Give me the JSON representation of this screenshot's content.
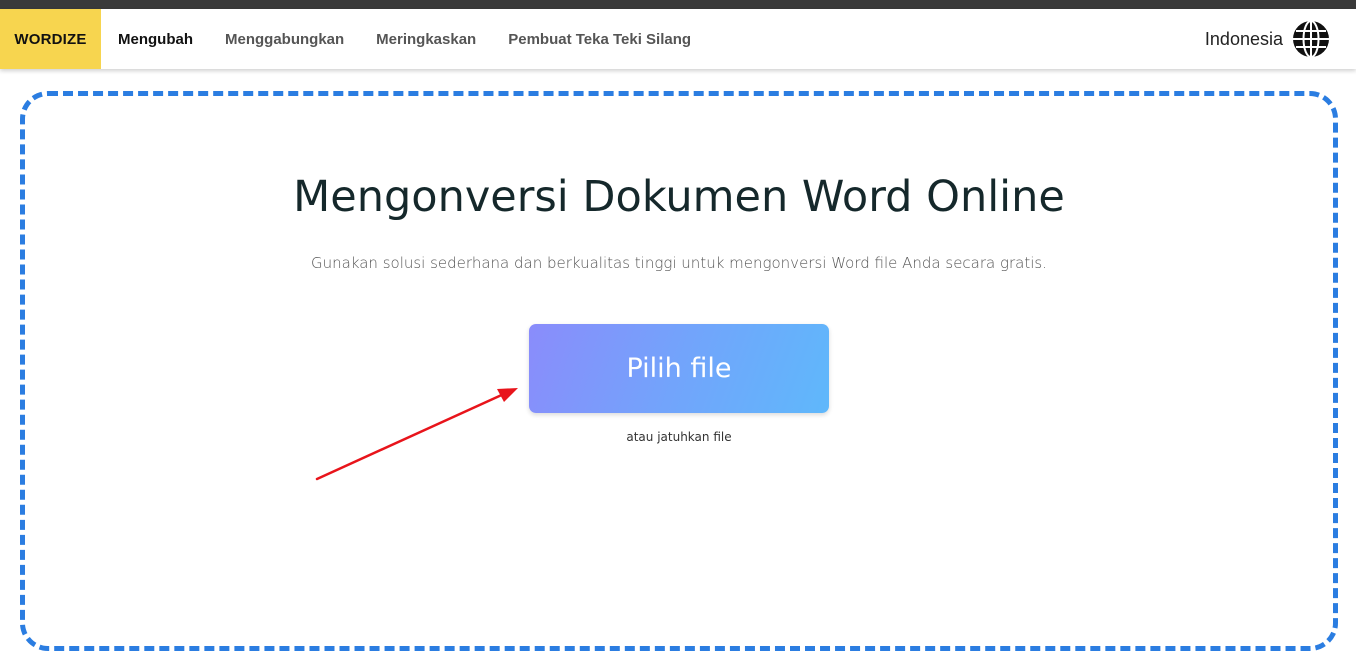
{
  "navbar": {
    "brand": "WORDIZE",
    "links": [
      {
        "label": "Mengubah",
        "active": true
      },
      {
        "label": "Menggabungkan",
        "active": false
      },
      {
        "label": "Meringkaskan",
        "active": false
      },
      {
        "label": "Pembuat Teka Teki Silang",
        "active": false
      }
    ],
    "language": "Indonesia",
    "language_icon": "globe-icon"
  },
  "main": {
    "title": "Mengonversi Dokumen Word Online",
    "subtitle": "Gunakan solusi sederhana dan berkualitas tinggi untuk mengonversi Word file Anda secara gratis.",
    "choose_button": "Pilih file",
    "drop_hint": "atau jatuhkan file"
  },
  "colors": {
    "brand_bg": "#f7d54f",
    "dropzone_border": "#2b7de1",
    "button_gradient_start": "#8a8cfb",
    "button_gradient_end": "#5fb8fb",
    "annotation_arrow": "#e8141b"
  }
}
